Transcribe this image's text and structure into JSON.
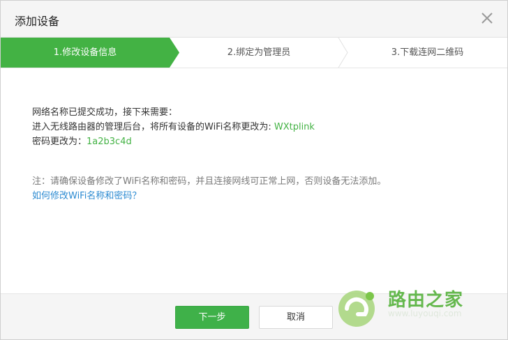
{
  "dialog": {
    "title": "添加设备",
    "close_icon": "close-icon"
  },
  "steps": [
    {
      "label": "1.修改设备信息",
      "active": true
    },
    {
      "label": "2.绑定为管理员",
      "active": false
    },
    {
      "label": "3.下载连网二维码",
      "active": false
    }
  ],
  "content": {
    "line1": "网络名称已提交成功，接下来需要：",
    "line2_prefix": "进入无线路由器的管理后台，将所有设备的WiFi名称更改为: ",
    "line2_value": "WXtplink",
    "line3_prefix": "密码更改为：",
    "line3_value": "1a2b3c4d"
  },
  "note": {
    "text": "注：请确保设备修改了WiFi名称和密码，并且连接网线可正常上网，否则设备无法添加。",
    "link": "如何修改WiFi名称和密码？"
  },
  "footer": {
    "next_label": "下一步",
    "cancel_label": "取消"
  },
  "watermark": {
    "brand": "路由之家",
    "sub": "www.luyouqi.com"
  },
  "colors": {
    "accent": "#3fb149",
    "link": "#2b8ad1"
  }
}
